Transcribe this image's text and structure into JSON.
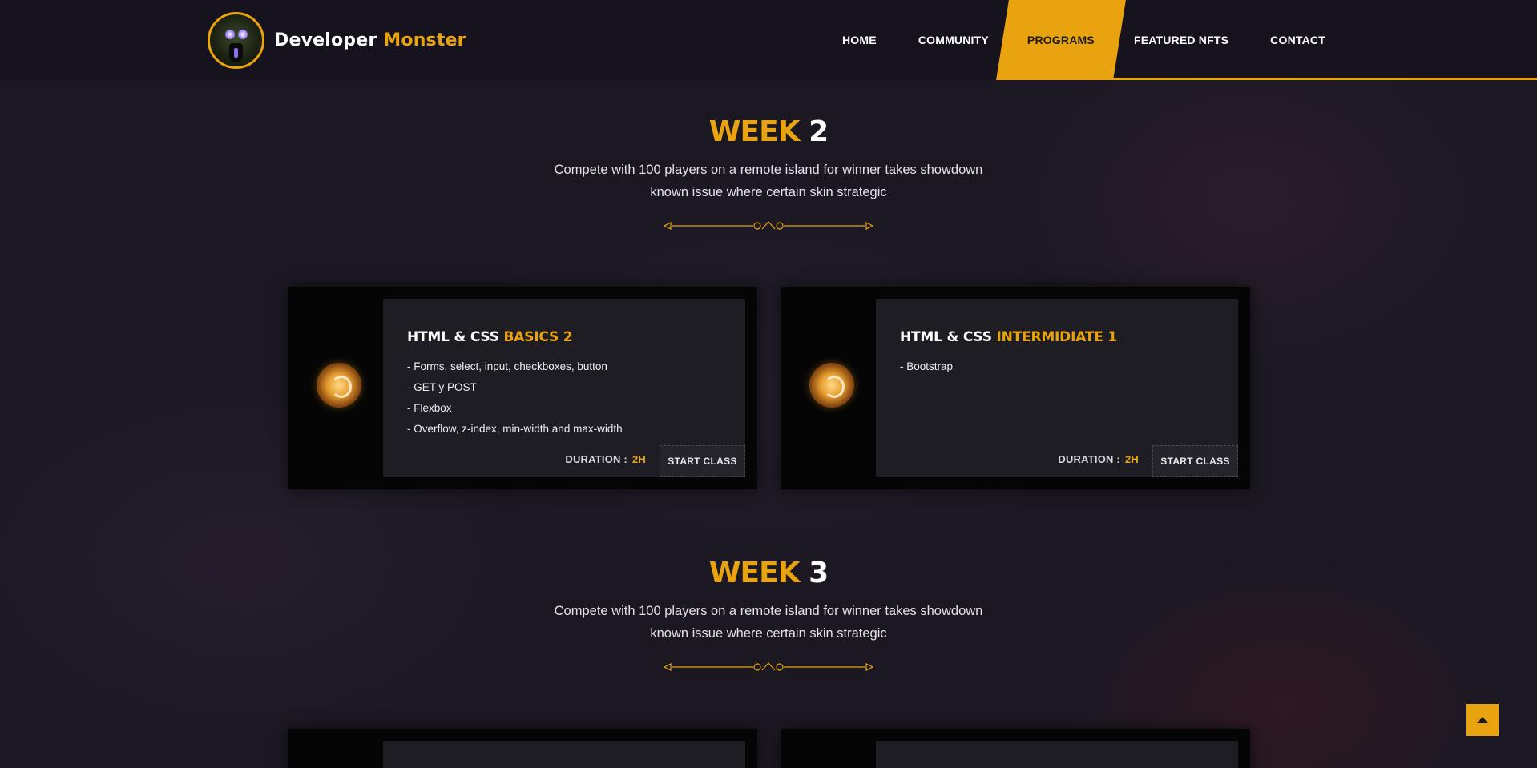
{
  "brand": {
    "name_part1": "Developer",
    "name_part2": "Monster",
    "logo_icon": "monster-logo-icon"
  },
  "nav": {
    "items": [
      {
        "label": "HOME",
        "active": false
      },
      {
        "label": "COMMUNITY",
        "active": false
      },
      {
        "label": "PROGRAMS",
        "active": true
      },
      {
        "label": "FEATURED NFTS",
        "active": false
      },
      {
        "label": "CONTACT",
        "active": false
      }
    ]
  },
  "weeks": [
    {
      "word": "WEEK",
      "number": "2",
      "subtitle_line1": "Compete with 100 players on a remote island for winner takes showdown",
      "subtitle_line2": "known issue where certain skin strategic",
      "cards": [
        {
          "title_white": "HTML & CSS",
          "title_accent": "BASICS 2",
          "items": [
            "- Forms, select, input, checkboxes, button",
            "- GET y POST",
            "- Flexbox",
            "- Overflow, z-index, min-width and max-width"
          ],
          "duration_label": "DURATION :",
          "duration_value": "2H",
          "button_label": "START CLASS",
          "icon": "gold-coin-icon"
        },
        {
          "title_white": "HTML & CSS",
          "title_accent": "INTERMIDIATE 1",
          "items": [
            "- Bootstrap"
          ],
          "duration_label": "DURATION :",
          "duration_value": "2H",
          "button_label": "START CLASS",
          "icon": "gold-coin-icon"
        }
      ]
    },
    {
      "word": "WEEK",
      "number": "3",
      "subtitle_line1": "Compete with 100 players on a remote island for winner takes showdown",
      "subtitle_line2": "known issue where certain skin strategic"
    }
  ],
  "colors": {
    "accent": "#e8a30e",
    "background": "#1c1822",
    "card": "#050506",
    "panel": "#1f1d24"
  },
  "scroll_top_icon": "arrow-up-icon"
}
